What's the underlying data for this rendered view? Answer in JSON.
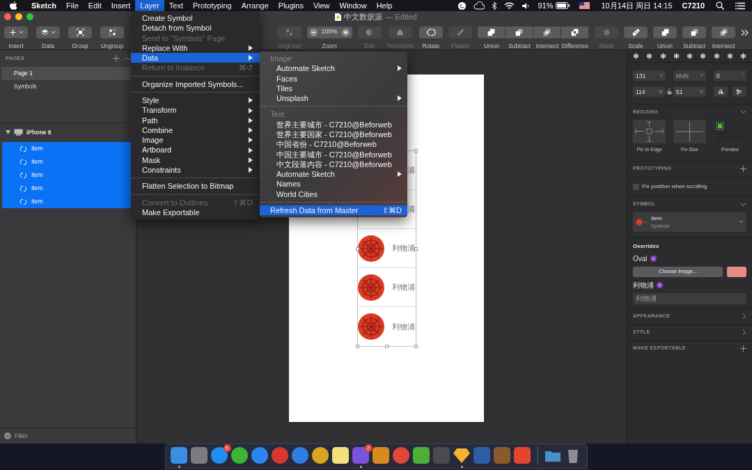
{
  "menu_bar": {
    "app_name": "Sketch",
    "menus": [
      {
        "label": "File",
        "selected": false
      },
      {
        "label": "Edit",
        "selected": false
      },
      {
        "label": "Insert",
        "selected": false
      },
      {
        "label": "Layer",
        "selected": true
      },
      {
        "label": "Text",
        "selected": false
      },
      {
        "label": "Prototyping",
        "selected": false
      },
      {
        "label": "Arrange",
        "selected": false
      },
      {
        "label": "Plugins",
        "selected": false
      },
      {
        "label": "View",
        "selected": false
      },
      {
        "label": "Window",
        "selected": false
      },
      {
        "label": "Help",
        "selected": false
      }
    ],
    "battery": "91%",
    "clock": "10月14日 周日 14:15",
    "user": "C7210"
  },
  "window": {
    "title": "中文数据源",
    "status": "— Edited"
  },
  "toolbar_left": [
    {
      "kind": "insert",
      "label": "Insert",
      "disabled": false
    },
    {
      "kind": "data",
      "label": "Data",
      "disabled": false
    },
    {
      "kind": "group",
      "label": "Group",
      "disabled": false
    },
    {
      "kind": "ungroup",
      "label": "Ungroup",
      "disabled": false
    }
  ],
  "toolbar_right": [
    {
      "kind": "ungroup",
      "label": "Ungroup",
      "disabled": true
    },
    {
      "kind": "zoom",
      "label": "Zoom",
      "value": "100%",
      "disabled": false
    },
    {
      "kind": "edit",
      "label": "Edit",
      "disabled": true
    },
    {
      "kind": "transform",
      "label": "Transform",
      "disabled": true
    },
    {
      "kind": "rotate",
      "label": "Rotate",
      "disabled": false
    },
    {
      "kind": "flatten",
      "label": "Flatten",
      "disabled": true
    },
    {
      "kind": "union",
      "label": "Union",
      "disabled": false,
      "segment": true
    },
    {
      "kind": "subtract",
      "label": "Subtract",
      "disabled": false,
      "segment": true
    },
    {
      "kind": "intersect",
      "label": "Intersect",
      "disabled": false,
      "segment": true
    },
    {
      "kind": "difference",
      "label": "Difference",
      "disabled": false,
      "segment": true
    },
    {
      "kind": "mask",
      "label": "Mask",
      "disabled": true
    },
    {
      "kind": "scale",
      "label": "Scale",
      "disabled": false
    },
    {
      "kind": "union",
      "label": "Union",
      "disabled": false
    },
    {
      "kind": "subtract",
      "label": "Subtract",
      "disabled": false
    },
    {
      "kind": "intersect",
      "label": "Intersect",
      "disabled": false
    }
  ],
  "pages": {
    "title": "PAGES",
    "items": [
      {
        "label": "Page 1",
        "selected": true
      },
      {
        "label": "Symbols",
        "selected": false
      }
    ]
  },
  "layers": [
    {
      "name": "iPhone 8",
      "expanded": true,
      "selected": false,
      "children": [
        {
          "name": "Item",
          "selected": true
        },
        {
          "name": "Item",
          "selected": true
        },
        {
          "name": "Item",
          "selected": true
        },
        {
          "name": "Item",
          "selected": true
        },
        {
          "name": "Item",
          "selected": true
        }
      ]
    }
  ],
  "filter": {
    "placeholder": "Filter"
  },
  "canvas": {
    "rows": [
      {
        "label": "浦",
        "emblem": false
      },
      {
        "label": "浦",
        "emblem": false
      },
      {
        "label": "利物浦",
        "emblem": true
      },
      {
        "label": "利物浦",
        "emblem": true
      },
      {
        "label": "利物浦",
        "emblem": true
      }
    ]
  },
  "inspector": {
    "position": [
      {
        "value": "131",
        "unit": "X"
      },
      {
        "placeholder": "Multi",
        "unit": "Y"
      },
      {
        "value": "0",
        "unit": "°"
      }
    ],
    "size": [
      {
        "value": "114",
        "unit": "W"
      },
      {
        "value": "51",
        "unit": "H"
      }
    ],
    "resizing": {
      "title": "RESIZING",
      "options": [
        "Pin to Edge",
        "Fix Size",
        "Preview"
      ]
    },
    "prototyping": {
      "title": "PROTOTYPING",
      "option": {
        "label": "Fix position when scrolling",
        "checked": false
      }
    },
    "symbol": {
      "title": "SYMBOL",
      "name": "Item",
      "path": "Symbols/"
    },
    "overrides": {
      "title": "Overrides",
      "items": [
        {
          "kind": "image",
          "label": "Oval",
          "button": "Choose Image..."
        },
        {
          "kind": "text",
          "label": "利物浦",
          "placeholder": "利物浦"
        }
      ]
    },
    "sections": [
      {
        "title": "APPEARANCE",
        "kind": "chevron"
      },
      {
        "title": "STYLE",
        "kind": "chevron"
      },
      {
        "title": "MAKE EXPORTABLE",
        "kind": "plus"
      }
    ]
  },
  "layer_menu": [
    {
      "kind": "item",
      "label": "Create Symbol",
      "disabled": false,
      "selected": false,
      "submenu": false
    },
    {
      "kind": "item",
      "label": "Detach from Symbol",
      "disabled": false,
      "selected": false,
      "submenu": false
    },
    {
      "kind": "item",
      "label": "Send to “Symbols” Page",
      "disabled": true,
      "selected": false,
      "submenu": false
    },
    {
      "kind": "item",
      "label": "Replace With",
      "disabled": false,
      "selected": false,
      "submenu": true
    },
    {
      "kind": "item",
      "label": "Data",
      "disabled": false,
      "selected": true,
      "submenu": true
    },
    {
      "kind": "item",
      "label": "Return to Instance",
      "disabled": true,
      "selected": false,
      "submenu": false,
      "shortcut": "⌘↺"
    },
    {
      "kind": "separator"
    },
    {
      "kind": "item",
      "label": "Organize Imported Symbols...",
      "disabled": false,
      "selected": false,
      "submenu": false
    },
    {
      "kind": "separator"
    },
    {
      "kind": "item",
      "label": "Style",
      "disabled": false,
      "selected": false,
      "submenu": true
    },
    {
      "kind": "item",
      "label": "Transform",
      "disabled": false,
      "selected": false,
      "submenu": true
    },
    {
      "kind": "item",
      "label": "Path",
      "disabled": false,
      "selected": false,
      "submenu": true
    },
    {
      "kind": "item",
      "label": "Combine",
      "disabled": false,
      "selected": false,
      "submenu": true
    },
    {
      "kind": "item",
      "label": "Image",
      "disabled": false,
      "selected": false,
      "submenu": true
    },
    {
      "kind": "item",
      "label": "Artboard",
      "disabled": false,
      "selected": false,
      "submenu": true
    },
    {
      "kind": "item",
      "label": "Mask",
      "disabled": false,
      "selected": false,
      "submenu": true
    },
    {
      "kind": "item",
      "label": "Constraints",
      "disabled": false,
      "selected": false,
      "submenu": true
    },
    {
      "kind": "separator"
    },
    {
      "kind": "item",
      "label": "Flatten Selection to Bitmap",
      "disabled": false,
      "selected": false,
      "submenu": false
    },
    {
      "kind": "separator"
    },
    {
      "kind": "item",
      "label": "Convert to Outlines",
      "disabled": true,
      "selected": false,
      "submenu": false,
      "shortcut": "⇧⌘O"
    },
    {
      "kind": "item",
      "label": "Make Exportable",
      "disabled": false,
      "selected": false,
      "submenu": false
    }
  ],
  "data_submenu": [
    {
      "kind": "header",
      "label": "Image"
    },
    {
      "kind": "item",
      "label": "Automate Sketch",
      "selected": false,
      "submenu": true
    },
    {
      "kind": "item",
      "label": "Faces",
      "selected": false,
      "submenu": false
    },
    {
      "kind": "item",
      "label": "Tiles",
      "selected": false,
      "submenu": false
    },
    {
      "kind": "item",
      "label": "Unsplash",
      "selected": false,
      "submenu": true
    },
    {
      "kind": "separator"
    },
    {
      "kind": "header",
      "label": "Text"
    },
    {
      "kind": "item",
      "label": "世界主要城市 - C7210@Beforweb",
      "selected": false,
      "submenu": false
    },
    {
      "kind": "item",
      "label": "世界主要国家 - C7210@Beforweb",
      "selected": false,
      "submenu": false
    },
    {
      "kind": "item",
      "label": "中国省份 - C7210@Beforweb",
      "selected": false,
      "submenu": false
    },
    {
      "kind": "item",
      "label": "中国主要城市 - C7210@Beforweb",
      "selected": false,
      "submenu": false
    },
    {
      "kind": "item",
      "label": "中文段落内容 - C7210@Beforweb",
      "selected": false,
      "submenu": false
    },
    {
      "kind": "item",
      "label": "Automate Sketch",
      "selected": false,
      "submenu": true
    },
    {
      "kind": "item",
      "label": "Names",
      "selected": false,
      "submenu": false
    },
    {
      "kind": "item",
      "label": "World Cities",
      "selected": false,
      "submenu": false
    },
    {
      "kind": "separator"
    },
    {
      "kind": "action",
      "label": "Refresh Data from Master",
      "selected": true,
      "submenu": false,
      "shortcut": "⇧⌘D"
    }
  ],
  "dock": [
    {
      "kind": "square",
      "color": "#3a8ee6",
      "running": true
    },
    {
      "kind": "square",
      "color": "#7b7b80",
      "running": false
    },
    {
      "kind": "circle",
      "color": "#1e8ef0",
      "running": false,
      "badge": "5"
    },
    {
      "kind": "circle",
      "color": "#3fb536",
      "running": false
    },
    {
      "kind": "circle",
      "color": "#2a86ee",
      "running": false
    },
    {
      "kind": "circle",
      "color": "#d8372f",
      "running": false
    },
    {
      "kind": "circle",
      "color": "#2f7fe3",
      "running": false
    },
    {
      "kind": "circle",
      "color": "#d9a520",
      "running": false
    },
    {
      "kind": "square",
      "color": "#f3e27c",
      "running": false
    },
    {
      "kind": "square",
      "color": "#7c52da",
      "running": true,
      "badge": "2"
    },
    {
      "kind": "square",
      "color": "#d98a1c",
      "running": false
    },
    {
      "kind": "circle",
      "color": "#e0463a",
      "running": false
    },
    {
      "kind": "square",
      "color": "#4fae3a",
      "running": false
    },
    {
      "kind": "square",
      "color": "#4a4a50",
      "running": false
    },
    {
      "kind": "diamond",
      "color": "#f7b22b",
      "running": true
    },
    {
      "kind": "square",
      "color": "#2e5da6",
      "running": false
    },
    {
      "kind": "square",
      "color": "#8a5a2a",
      "running": false
    },
    {
      "kind": "square",
      "color": "#e5452f",
      "running": false
    },
    {
      "kind": "divider"
    },
    {
      "kind": "folder",
      "color": "#4a90c8",
      "running": false
    },
    {
      "kind": "bin",
      "color": "#8d8d92",
      "running": false
    }
  ]
}
